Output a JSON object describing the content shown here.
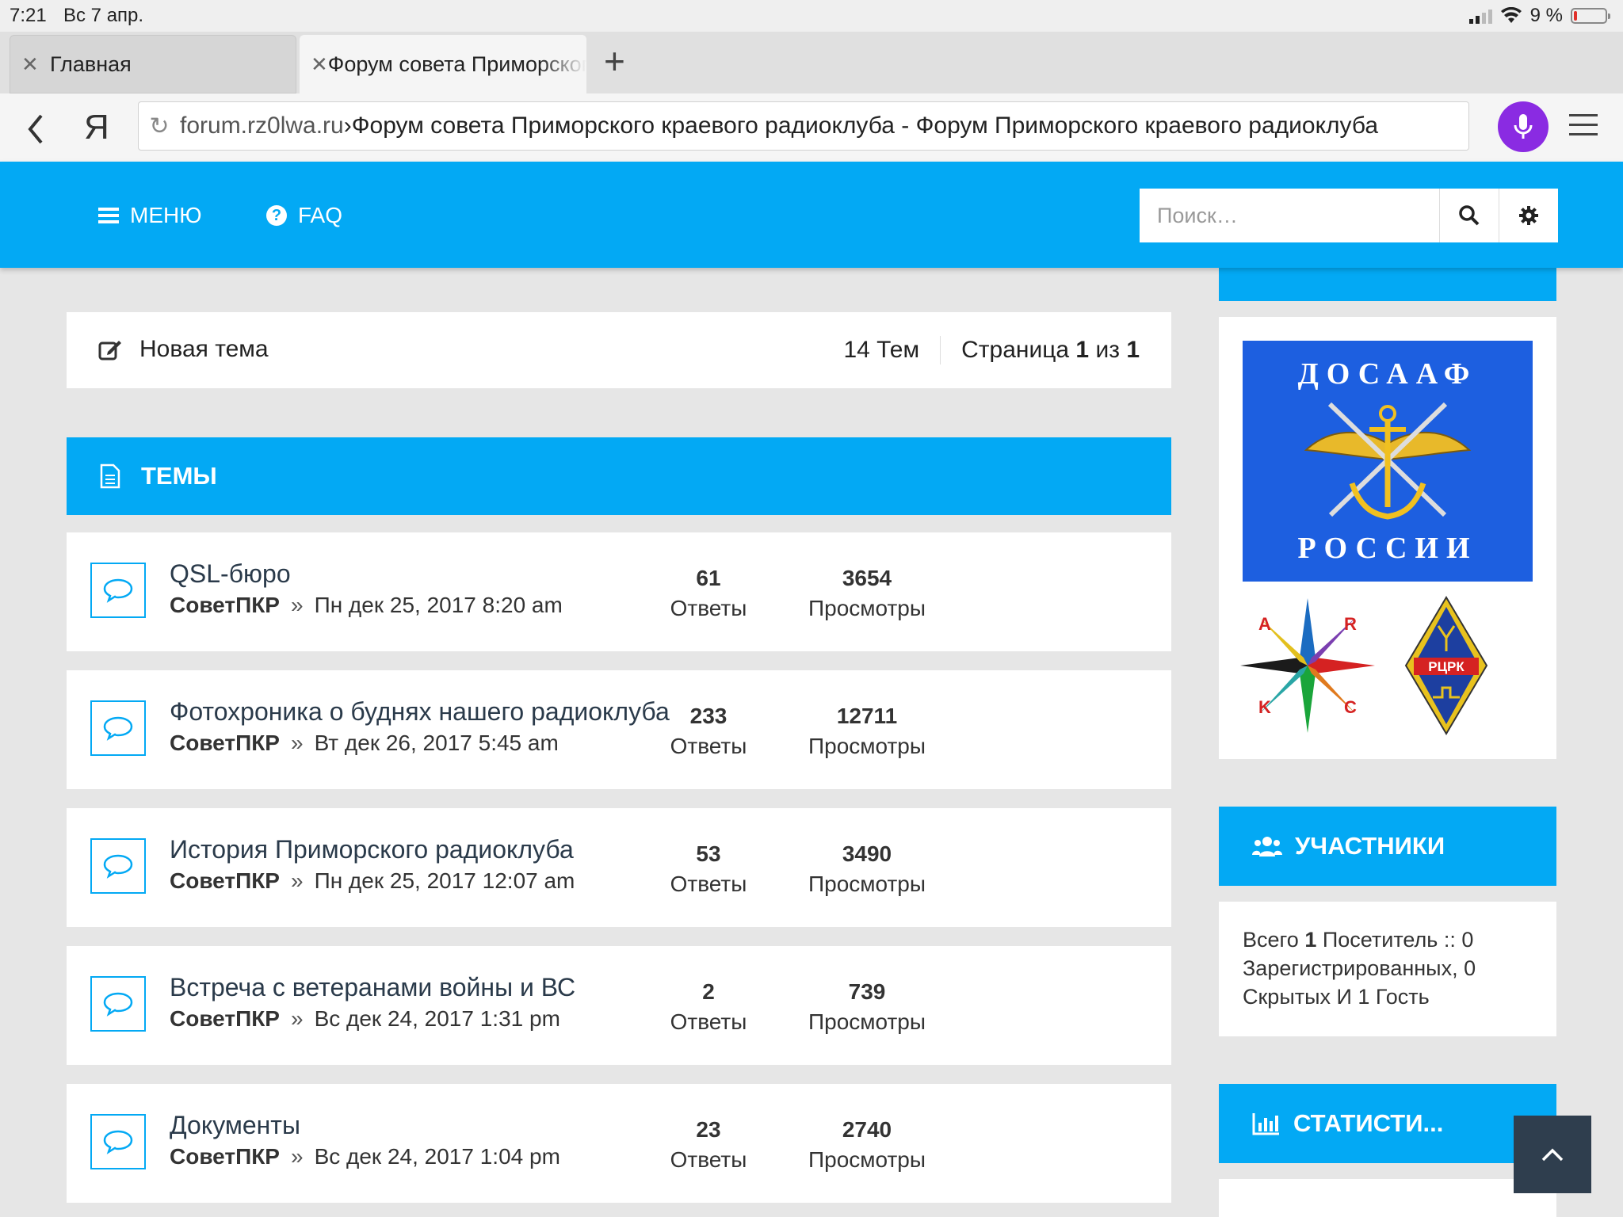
{
  "status": {
    "time": "7:21",
    "date": "Вс 7 апр.",
    "battery": "9 %"
  },
  "tabs": [
    {
      "label": "Главная"
    },
    {
      "label": "Форум совета Приморского краевого радиоклуба"
    }
  ],
  "address": {
    "domain": "forum.rz0lwa.ru",
    "sep": " › ",
    "title": "Форум совета Приморского краевого радиоклуба - Форум Приморского краевого радиоклуба"
  },
  "nav": {
    "menu": "МЕНЮ",
    "faq": "FAQ",
    "search_placeholder": "Поиск…"
  },
  "toolbar": {
    "new_topic": "Новая тема",
    "topics_count": "14 Тем",
    "page_label": "Страница",
    "page_cur": "1",
    "page_of": "из",
    "page_total": "1"
  },
  "topics_header": "ТЕМЫ",
  "replies_label": "Ответы",
  "views_label": "Просмотры",
  "topics": [
    {
      "title": "QSL-бюро",
      "author": "СоветПКР",
      "date": "Пн дек 25, 2017 8:20 am",
      "replies": "61",
      "views": "3654"
    },
    {
      "title": "Фотохроника о буднях нашего радиоклуба",
      "author": "СоветПКР",
      "date": "Вт дек 26, 2017 5:45 am",
      "replies": "233",
      "views": "12711"
    },
    {
      "title": "История Приморского радиоклуба",
      "author": "СоветПКР",
      "date": "Пн дек 25, 2017 12:07 am",
      "replies": "53",
      "views": "3490"
    },
    {
      "title": "Встреча с ветеранами войны и ВС",
      "author": "СоветПКР",
      "date": "Вс дек 24, 2017 1:31 pm",
      "replies": "2",
      "views": "739"
    },
    {
      "title": "Документы",
      "author": "СоветПКР",
      "date": "Вс дек 24, 2017 1:04 pm",
      "replies": "23",
      "views": "2740"
    }
  ],
  "sidebar": {
    "dosaaf_top": "ДОСААФ",
    "dosaaf_bottom": "РОССИИ",
    "rck_label": "РЦРК",
    "members_title": "УЧАСТНИКИ",
    "members_text": {
      "a": "Всего ",
      "b": "1",
      "c": " Посетитель :: 0",
      "d": "Зарегистрированных, 0",
      "e": "Скрытых И 1 Гость"
    },
    "stats_title": "СТАТИСТИ..."
  },
  "colors": {
    "accent": "#03a9f4",
    "mic": "#8a2be2",
    "to_top": "#2f3e4e"
  }
}
